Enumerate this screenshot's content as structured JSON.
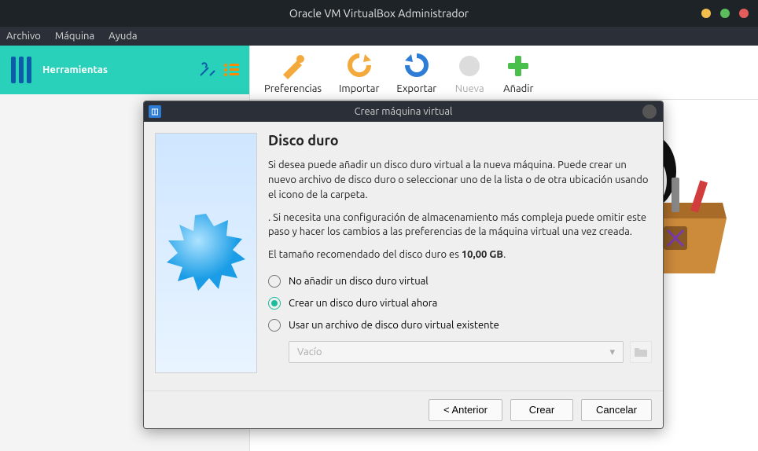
{
  "window": {
    "title": "Oracle VM VirtualBox Administrador"
  },
  "menu": {
    "file": "Archivo",
    "machine": "Máquina",
    "help": "Ayuda"
  },
  "sidebar": {
    "tools_label": "Herramientas"
  },
  "toolbar": {
    "preferences": "Preferencias",
    "import": "Importar",
    "export": "Exportar",
    "new": "Nueva",
    "add": "Añadir"
  },
  "modal": {
    "title": "Crear máquina virtual",
    "heading": "Disco duro",
    "para1": "Si desea puede añadir un disco duro virtual a la nueva máquina. Puede crear un nuevo archivo de disco duro o seleccionar uno de la lista o de otra ubicación usando el icono de la carpeta.",
    "para2": ". Si necesita una configuración de almacenamiento más compleja puede omitir este paso y hacer los cambios a las preferencias de la máquina virtual una vez creada.",
    "para3_prefix": "El tamaño recomendado del disco duro es ",
    "para3_value": "10,00 GB",
    "para3_suffix": ".",
    "options": {
      "opt1": "No añadir un disco duro virtual",
      "opt2": "Crear un disco duro virtual ahora",
      "opt3": "Usar un archivo de disco duro virtual existente"
    },
    "dropdown_value": "Vacío",
    "buttons": {
      "back": "< Anterior",
      "create": "Crear",
      "cancel": "Cancelar"
    }
  }
}
